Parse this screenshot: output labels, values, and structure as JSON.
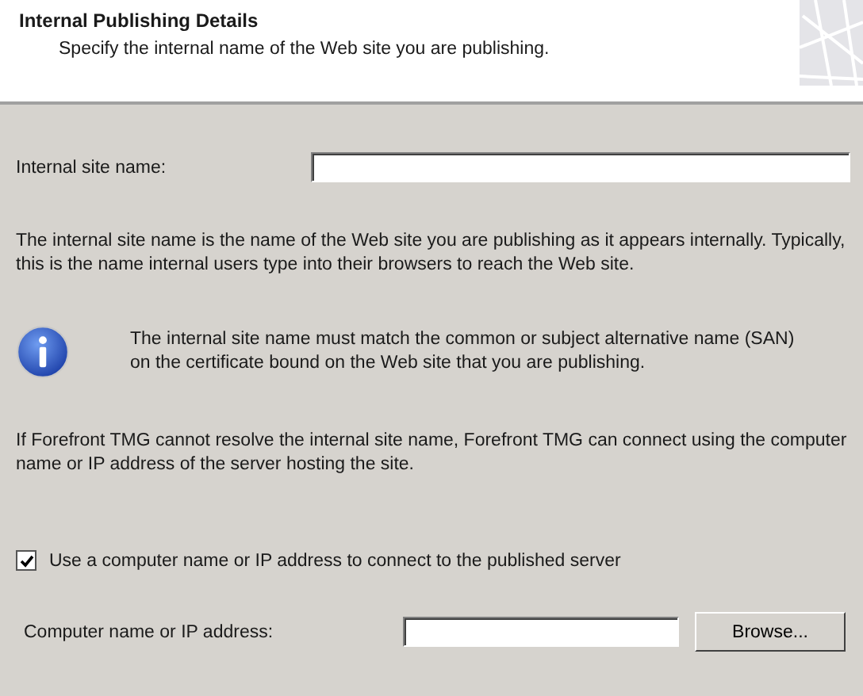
{
  "header": {
    "title": "Internal Publishing Details",
    "subtitle": "Specify the internal name of the Web site you are publishing."
  },
  "site_name": {
    "label": "Internal site name:"
  },
  "description": "The internal site name is the name of the Web site you are publishing as it appears internally. Typically, this is the name internal users type into their browsers to reach the Web site.",
  "info_note": "The internal site name must match the common or subject alternative name (SAN) on the certificate bound on the Web site that you are publishing.",
  "fallback_note": "If Forefront TMG cannot resolve the internal site name, Forefront TMG can connect using the computer name or IP address of the server hosting the site.",
  "use_computer_name": {
    "label": "Use a computer name or IP address to connect to the published server",
    "checked": true
  },
  "computer_name": {
    "label": "Computer name or IP address:",
    "button": "Browse..."
  }
}
